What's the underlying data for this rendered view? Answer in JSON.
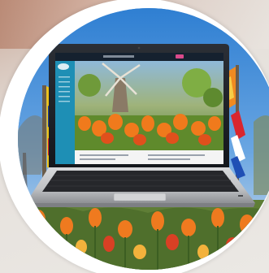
{
  "image": {
    "subject": "laptop-with-tulip-website",
    "colors": {
      "sky": "#3b86d6",
      "tulip_orange": "#ef7a1f",
      "tulip_red": "#d94024",
      "laptop_silver": "#c9cacc",
      "keyboard": "#2b2c2f",
      "screen_dark": "#1a2230",
      "site_sidebar": "#1e8fb5"
    }
  }
}
